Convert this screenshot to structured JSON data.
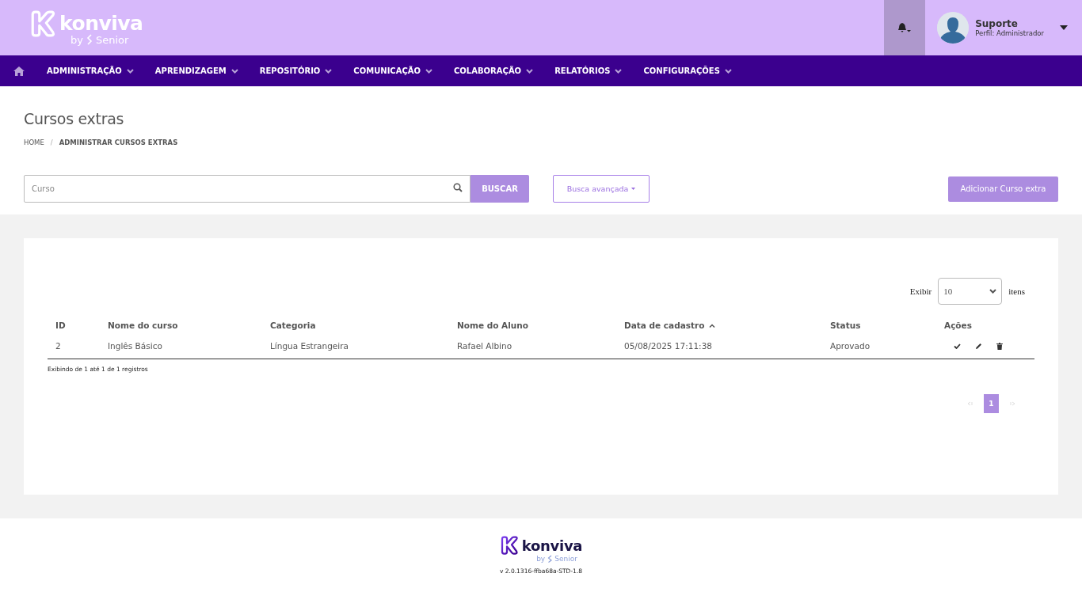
{
  "header": {
    "logo": {
      "name": "konviva",
      "byline": "by",
      "brand": "Senior"
    },
    "notifications": {
      "has_menu": true
    },
    "user": {
      "name": "Suporte",
      "role": "Perfil: Administrador"
    }
  },
  "nav": {
    "items": [
      {
        "label": "ADMINISTRAÇÃO",
        "has_menu": true
      },
      {
        "label": "APRENDIZAGEM",
        "has_menu": true
      },
      {
        "label": "REPOSITÓRIO",
        "has_menu": true
      },
      {
        "label": "COMUNICAÇÃO",
        "has_menu": true
      },
      {
        "label": "COLABORAÇÃO",
        "has_menu": true
      },
      {
        "label": "RELATÓRIOS",
        "has_menu": true
      },
      {
        "label": "CONFIGURAÇÕES",
        "has_menu": true
      }
    ]
  },
  "page": {
    "title": "Cursos extras",
    "breadcrumb_separator": "/",
    "breadcrumb": [
      {
        "label": "HOME",
        "current": false
      },
      {
        "label": "ADMINISTRAR CURSOS EXTRAS",
        "current": true
      }
    ]
  },
  "search": {
    "placeholder": "Curso",
    "button": "BUSCAR",
    "advanced": "Busca avançada",
    "add_button": "Adicionar Curso extra"
  },
  "table": {
    "page_size": {
      "before": "Exibir",
      "value": "10",
      "after": "itens"
    },
    "columns": [
      {
        "label": "ID",
        "sorted": false
      },
      {
        "label": "Nome do curso",
        "sorted": false
      },
      {
        "label": "Categoria",
        "sorted": false
      },
      {
        "label": "Nome do Aluno",
        "sorted": false
      },
      {
        "label": "Data de cadastro",
        "sorted": true
      },
      {
        "label": "Status",
        "sorted": false
      },
      {
        "label": "Ações",
        "sorted": false
      }
    ],
    "rows": [
      {
        "cells": [
          "2",
          "Inglês Básico",
          "Língua Estrangeira",
          "Rafael Albino",
          "05/08/2025 17:11:38",
          "Aprovado"
        ],
        "actions": [
          {
            "kind": "approve"
          },
          {
            "kind": "edit"
          },
          {
            "kind": "delete"
          }
        ]
      }
    ],
    "info": "Exibindo de 1 até 1 de 1 registros",
    "pagination": {
      "first_disabled": true,
      "last_disabled": true,
      "pages": [
        {
          "label": "1",
          "selected": true
        }
      ]
    }
  },
  "footer": {
    "logo": {
      "name": "konviva",
      "byline": "by",
      "brand": "Senior"
    },
    "version": "v 2.0.1316-ffba68a-STD-1.8"
  }
}
